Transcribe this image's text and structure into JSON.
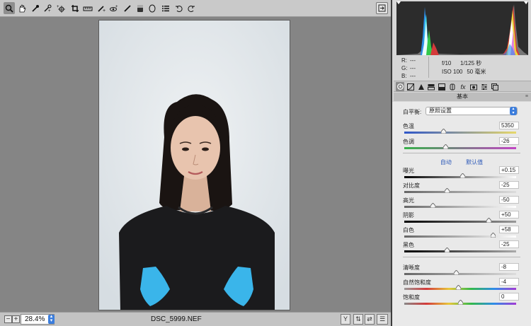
{
  "toolbar": {
    "tools": [
      {
        "name": "zoom-tool",
        "icon": "magnifier"
      },
      {
        "name": "hand-tool",
        "icon": "hand"
      },
      {
        "name": "white-balance-tool",
        "icon": "eyedropper"
      },
      {
        "name": "color-sampler-tool",
        "icon": "eyedropper-plus"
      },
      {
        "name": "targeted-adjustment-tool",
        "icon": "target-plus"
      },
      {
        "name": "crop-tool",
        "icon": "crop"
      },
      {
        "name": "straighten-tool",
        "icon": "level"
      },
      {
        "name": "spot-removal-tool",
        "icon": "brush-heal"
      },
      {
        "name": "red-eye-tool",
        "icon": "eye-plus"
      },
      {
        "name": "adjustment-brush-tool",
        "icon": "brush"
      },
      {
        "name": "graduated-filter-tool",
        "icon": "rect-gradient"
      },
      {
        "name": "radial-filter-tool",
        "icon": "ellipse"
      },
      {
        "name": "preferences-tool",
        "icon": "list"
      },
      {
        "name": "rotate-ccw-tool",
        "icon": "rotate-left"
      },
      {
        "name": "rotate-cw-tool",
        "icon": "rotate-right"
      }
    ],
    "fullscreen_icon": "fullscreen"
  },
  "status": {
    "zoom": "28.4%",
    "filename": "DSC_5999.NEF"
  },
  "readout": {
    "r_label": "R:",
    "r_value": "---",
    "g_label": "G:",
    "g_value": "---",
    "b_label": "B:",
    "b_value": "---",
    "aperture": "f/10",
    "shutter": "1/125 秒",
    "iso": "ISO 100",
    "focal": "50 毫米"
  },
  "panel": {
    "title": "基本",
    "wb_label": "白平衡:",
    "wb_value": "原照设置",
    "auto_link": "自动",
    "default_link": "默认值",
    "sliders": [
      {
        "key": "temp",
        "label": "色温",
        "value": "5350",
        "fraction": 0.35
      },
      {
        "key": "tint",
        "label": "色调",
        "value": "-26",
        "fraction": 0.37
      },
      {
        "key": "exposure",
        "label": "曝光",
        "value": "+0.15",
        "fraction": 0.52
      },
      {
        "key": "contrast",
        "label": "对比度",
        "value": "-25",
        "fraction": 0.38
      },
      {
        "key": "highlights",
        "label": "高光",
        "value": "-50",
        "fraction": 0.25
      },
      {
        "key": "shadows",
        "label": "阴影",
        "value": "+50",
        "fraction": 0.75
      },
      {
        "key": "whites",
        "label": "白色",
        "value": "+58",
        "fraction": 0.79
      },
      {
        "key": "blacks",
        "label": "黑色",
        "value": "-25",
        "fraction": 0.38
      },
      {
        "key": "clarity",
        "label": "清晰度",
        "value": "-8",
        "fraction": 0.46
      },
      {
        "key": "vibrance",
        "label": "自然饱和度",
        "value": "-4",
        "fraction": 0.48
      },
      {
        "key": "saturation",
        "label": "饱和度",
        "value": "0",
        "fraction": 0.5
      }
    ]
  },
  "colors": {
    "accent": "#3b7ddc",
    "link": "#2a57b8"
  }
}
